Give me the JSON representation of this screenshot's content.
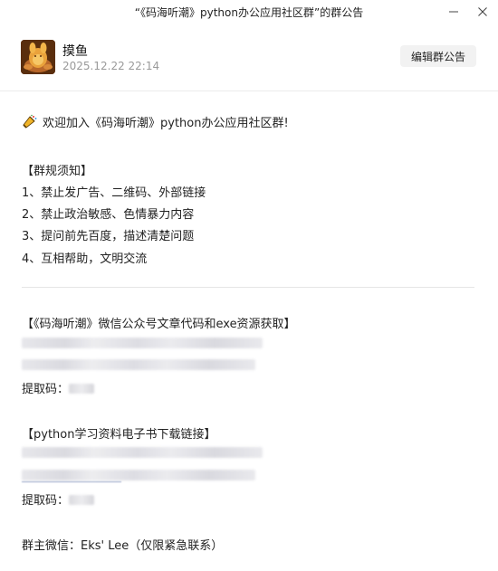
{
  "window": {
    "title": "“《码海听潮》python办公应用社区群”的群公告",
    "min_icon": "minimize-icon",
    "close_icon": "close-icon"
  },
  "header": {
    "author": "摸鱼",
    "datetime": "2025.12.22 22:14",
    "edit_button": "编辑群公告",
    "avatar_icon": "avatar-image"
  },
  "announcement": {
    "welcome": "欢迎加入《码海听潮》python办公应用社区群!",
    "welcome_icon": "megaphone-icon",
    "rules_title": "【群规须知】",
    "rules": [
      "1、禁止发广告、二维码、外部链接",
      "2、禁止政治敏感、色情暴力内容",
      "3、提问前先百度，描述清楚问题",
      "4、互相帮助，文明交流"
    ],
    "resource1_title": "【《码海听潮》微信公众号文章代码和exe资源获取】",
    "resource1_code_label": "提取码：",
    "resource2_title": "【python学习资料电子书下载链接】",
    "resource2_code_label": "提取码：",
    "owner_contact": "群主微信：Eks' Lee（仅限紧急联系）"
  },
  "colors": {
    "accent_text": "#1f1f1f",
    "muted_text": "#9a9a9a",
    "button_bg": "#f2f2f2",
    "divider": "#e6e6e6"
  }
}
